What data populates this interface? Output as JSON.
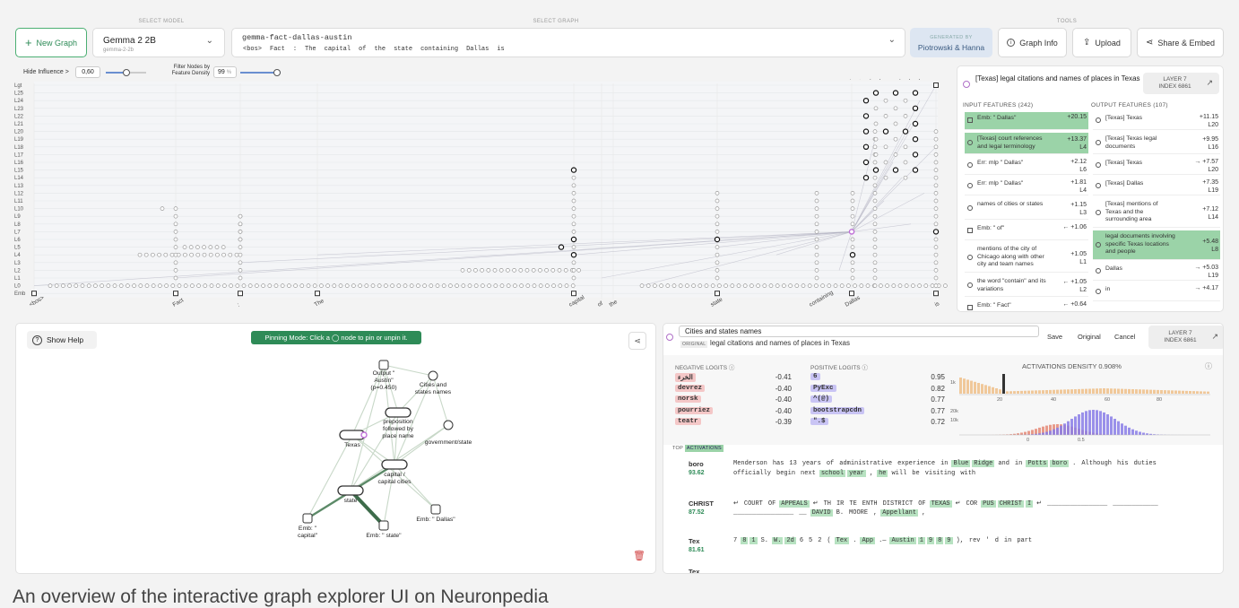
{
  "colors": {
    "accent": "#2e8b57",
    "highlight": "#9bd3a8",
    "neg": "#f4c7c7",
    "pos": "#c9c4f4",
    "node_pin": "#c88bd8"
  },
  "header": {
    "select_model_label": "SELECT MODEL",
    "select_graph_label": "SELECT GRAPH",
    "tools_label": "TOOLS",
    "new_graph": "New Graph",
    "model_name": "Gemma 2 2B",
    "model_id": "gemma-2-2b",
    "graph_name": "gemma-fact-dallas-austin",
    "prompt_tokens": [
      "<bos>",
      "Fact",
      ":",
      "The",
      "capital",
      "of",
      "the",
      "state",
      "containing",
      "Dallas",
      "is"
    ],
    "generated_by_label": "GENERATED BY",
    "generated_by": "Piotrowski & Hanna",
    "graph_info": "Graph Info",
    "upload": "Upload",
    "share": "Share & Embed"
  },
  "controls": {
    "hide_influence": "Hide Influence >",
    "hide_influence_value": "0,60",
    "filter_nodes": "Filter Nodes by Feature Density",
    "filter_value": "99",
    "filter_unit": "%"
  },
  "graph": {
    "layers": [
      "Lgt",
      "L25",
      "L24",
      "L23",
      "L22",
      "L21",
      "L20",
      "L19",
      "L18",
      "L17",
      "L16",
      "L15",
      "L14",
      "L13",
      "L12",
      "L11",
      "L10",
      "L9",
      "L8",
      "L7",
      "L6",
      "L5",
      "L4",
      "L3",
      "L2",
      "L1",
      "L0",
      "Emb"
    ],
    "x_tokens": [
      "<bos>",
      "Fact",
      ":",
      "The",
      "capital",
      "of",
      "the",
      "state",
      "containing",
      "Dallas",
      "is"
    ],
    "top_tokens": [
      "Sac",
      "Oklahoma",
      "Dallas",
      "Austin",
      "Tallahassee",
      "Denver",
      "Atlanta",
      "Austin"
    ]
  },
  "node_detail": {
    "title": "[Texas] legal citations and names of places in Texas",
    "layer": "LAYER 7",
    "index": "INDEX 6861",
    "input_label": "INPUT FEATURES (242)",
    "output_label": "OUTPUT FEATURES (107)",
    "inputs": [
      {
        "name": "Emb: \" Dallas\"",
        "val": "+20.15",
        "layer": "",
        "hl": true
      },
      {
        "name": "[Texas] court references and legal terminology",
        "val": "+13.37",
        "layer": "L4",
        "hl": true
      },
      {
        "name": "Err: mlp \" Dallas\"",
        "val": "+2.12",
        "layer": "L6",
        "hl": false
      },
      {
        "name": "Err: mlp \" Dallas\"",
        "val": "+1.81",
        "layer": "L4",
        "hl": false
      },
      {
        "name": "names of cities or states",
        "val": "+1.15",
        "layer": "L3",
        "hl": false
      },
      {
        "name": "Emb: \" of\"",
        "val": "← +1.06",
        "layer": "",
        "hl": false
      },
      {
        "name": "mentions of the city of Chicago along with other city and team names",
        "val": "+1.05",
        "layer": "L1",
        "hl": false
      },
      {
        "name": "the word \"contain\" and its variations",
        "val": "← +1.05",
        "layer": "L2",
        "hl": false
      },
      {
        "name": "Emb: \" Fact\"",
        "val": "← +0.64",
        "layer": "",
        "hl": false
      }
    ],
    "outputs": [
      {
        "name": "[Texas] Texas",
        "val": "+11.15",
        "layer": "L20",
        "hl": false
      },
      {
        "name": "[Texas] Texas legal documents",
        "val": "+9.95",
        "layer": "L16",
        "hl": false
      },
      {
        "name": "[Texas] Texas",
        "val": "→ +7.57",
        "layer": "L20",
        "hl": false
      },
      {
        "name": "[Texas] Dallas",
        "val": "+7.35",
        "layer": "L19",
        "hl": false
      },
      {
        "name": "[Texas] mentions of Texas and the surrounding area",
        "val": "+7.12",
        "layer": "L14",
        "hl": false
      },
      {
        "name": "legal documents involving specific Texas locations and people",
        "val": "+5.48",
        "layer": "L8",
        "hl": true
      },
      {
        "name": "Dallas",
        "val": "→ +5.03",
        "layer": "L19",
        "hl": false
      },
      {
        "name": "in",
        "val": "→ +4.17",
        "layer": "",
        "hl": false
      }
    ]
  },
  "subgraph": {
    "show_help": "Show Help",
    "pinning": "Pinning Mode: Click a ◯ node to pin or unpin it.",
    "nodes": [
      "Output \" Austin\" (p=0.450)",
      "Cities and states names",
      "preposition followed by place name",
      "government/state",
      "Texas",
      "capital / capital cities",
      "state",
      "Emb: \" capital\"",
      "Emb: \" state\"",
      "Emb: \" Dallas\""
    ]
  },
  "feature": {
    "name_input": "Cities and states names",
    "original_badge": "ORIGINAL",
    "original_text": "legal citations and names of places in Texas",
    "save": "Save",
    "original": "Original",
    "cancel": "Cancel",
    "layer": "LAYER 7",
    "index": "INDEX 6861",
    "neg_label": "NEGATIVE LOGITS",
    "pos_label": "POSITIVE LOGITS",
    "density_label": "ACTIVATIONS DENSITY 0.908%",
    "neg": [
      {
        "t": "الخرء",
        "v": "-0.41"
      },
      {
        "t": "devrez",
        "v": "-0.40"
      },
      {
        "t": "norsk",
        "v": "-0.40"
      },
      {
        "t": "pourriez",
        "v": "-0.40"
      },
      {
        "t": "teatr",
        "v": "-0.39"
      }
    ],
    "pos": [
      {
        "t": "6",
        "v": "0.95"
      },
      {
        "t": "PyExc",
        "v": "0.82"
      },
      {
        "t": "^(@)",
        "v": "0.77"
      },
      {
        "t": "bootstrapcdn",
        "v": "0.77"
      },
      {
        "t": "\".$",
        "v": "0.72"
      }
    ],
    "hist_top_ticks": [
      "1k",
      "20",
      "40",
      "60",
      "80"
    ],
    "hist_bot_ticks": [
      "20k",
      "10k",
      "0",
      "0.5"
    ],
    "top_label": "TOP",
    "activations_label": "ACTIVATIONS",
    "acts": [
      {
        "tok": "boro",
        "val": "93.62",
        "line1": "Menderson has 13 years of administrative experience in Blue Ridge and in Potts boro . Although his duties",
        "line2": "officially begin next school year , he will be visiting with"
      },
      {
        "tok": "CHRIST",
        "val": "87.52",
        "line1": "↵ COURT OF APPEALS ↵ TH IR TE ENTH DISTRICT OF TEXAS ↵ COR PUS CHRIST I ↵ ________________ ____________",
        "line2": "________________ __ DAVID B. MOORE , Appellant ,"
      },
      {
        "tok": "Tex",
        "val": "81.61",
        "line1": "7 8 1 S. W. 2d 6 5 2 ( Tex . App .— Austin 1 9 8 9 ), rev ' d in part",
        "line2": ""
      },
      {
        "tok": "Tex",
        "val": "",
        "line1": "",
        "line2": ""
      }
    ]
  },
  "caption": "An overview of the interactive graph explorer UI on Neuronpedia"
}
